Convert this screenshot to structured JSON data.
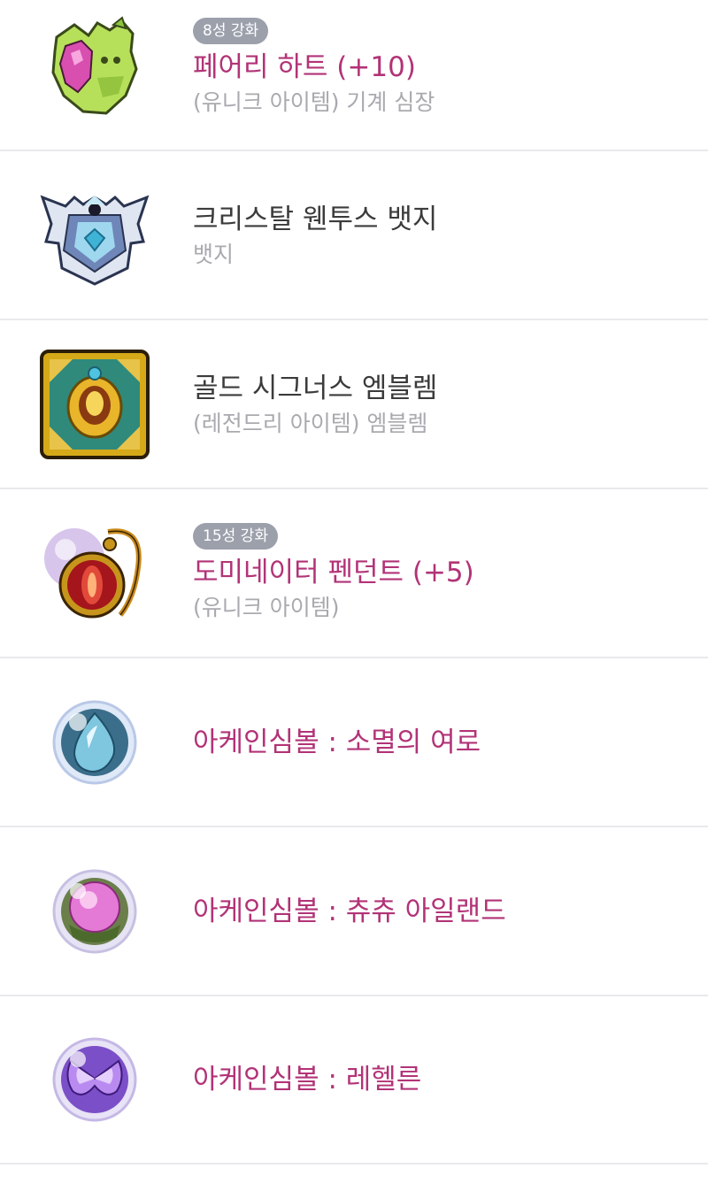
{
  "items": [
    {
      "badge": "8성 강화",
      "name": "페어리 하트 (+10)",
      "subtitle": "(유니크 아이템) 기계 심장",
      "name_color": "pink",
      "icon": "fairy-heart-icon"
    },
    {
      "name": "크리스탈 웬투스 뱃지",
      "subtitle": "뱃지",
      "name_color": "dark",
      "icon": "crystal-badge-icon"
    },
    {
      "name": "골드 시그너스 엠블렘",
      "subtitle": "(레전드리 아이템) 엠블렘",
      "name_color": "dark",
      "icon": "gold-emblem-icon"
    },
    {
      "badge": "15성 강화",
      "name": "도미네이터 펜던트 (+5)",
      "subtitle": "(유니크 아이템)",
      "name_color": "pink",
      "icon": "dominator-pendant-icon"
    },
    {
      "name": "아케인심볼 : 소멸의 여로",
      "name_color": "pink",
      "icon": "arcane-symbol-blue-icon"
    },
    {
      "name": "아케인심볼 : 츄츄 아일랜드",
      "name_color": "pink",
      "icon": "arcane-symbol-pink-icon"
    },
    {
      "name": "아케인심볼 : 레헬른",
      "name_color": "pink",
      "icon": "arcane-symbol-purple-icon"
    }
  ],
  "colors": {
    "pink": "#b23377",
    "dark": "#3b3b3b",
    "subtitle": "#a9a9af",
    "badge_bg": "#9ba0ab",
    "divider": "#e9e9ec"
  }
}
